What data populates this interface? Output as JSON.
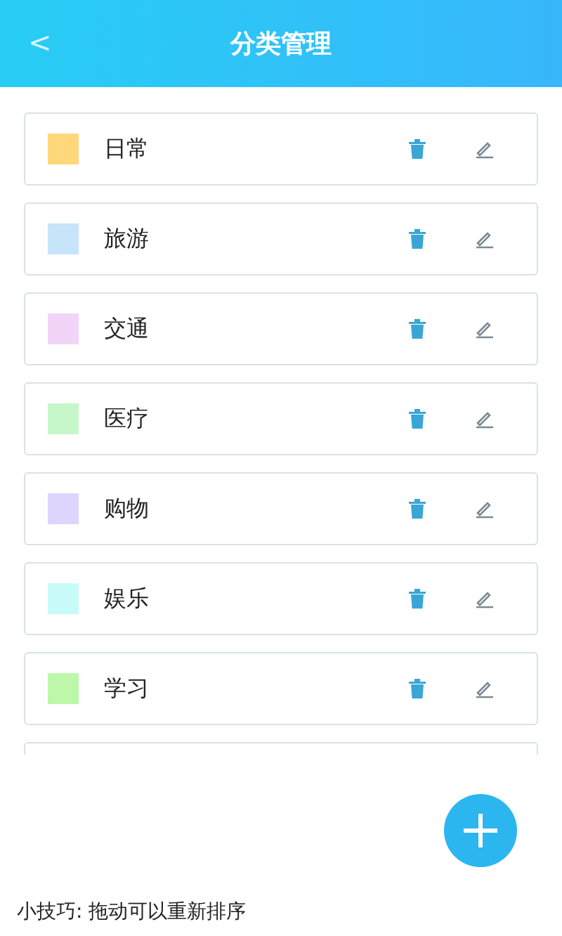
{
  "header": {
    "back": "<",
    "title": "分类管理"
  },
  "categories": [
    {
      "name": "日常",
      "color": "#ffd87c"
    },
    {
      "name": "旅游",
      "color": "#c6e4fa"
    },
    {
      "name": "交通",
      "color": "#f2d4f8"
    },
    {
      "name": "医疗",
      "color": "#c6f7ca"
    },
    {
      "name": "购物",
      "color": "#ddd5fb"
    },
    {
      "name": "娱乐",
      "color": "#c9fafa"
    },
    {
      "name": "学习",
      "color": "#bcf7aa"
    }
  ],
  "tip": "小技巧: 拖动可以重新排序"
}
